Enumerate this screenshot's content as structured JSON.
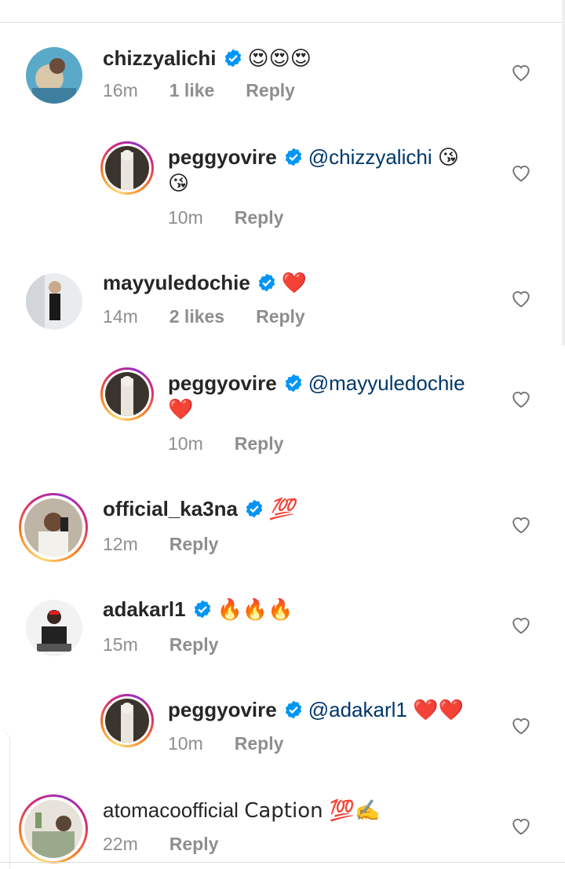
{
  "comments": [
    {
      "username": "chizzyalichi",
      "text": "😍😍😍",
      "time": "16m",
      "likes": "1 like",
      "reply": "Reply"
    },
    {
      "username": "peggyovire",
      "mention": "@chizzyalichi",
      "text": "😘",
      "text2": "😘",
      "time": "10m",
      "reply": "Reply"
    },
    {
      "username": "mayyuledochie",
      "text": "❤️",
      "time": "14m",
      "likes": "2 likes",
      "reply": "Reply"
    },
    {
      "username": "peggyovire",
      "mention": "@mayyuledochie",
      "text2": "❤️",
      "time": "10m",
      "reply": "Reply"
    },
    {
      "username": "official_ka3na",
      "text": "💯",
      "time": "12m",
      "reply": "Reply"
    },
    {
      "username": "adakarl1",
      "text": "🔥🔥🔥",
      "time": "15m",
      "reply": "Reply"
    },
    {
      "username": "peggyovire",
      "mention": "@adakarl1",
      "text": "❤️❤️",
      "time": "10m",
      "reply": "Reply"
    },
    {
      "username": "atomacoofficial",
      "text": "Caption 💯✍️",
      "time": "22m",
      "reply": "Reply"
    }
  ],
  "colors": {
    "mention": "#00376b",
    "meta": "#8e8e8e",
    "verified": "#0095f6",
    "heart": "#e0245e"
  },
  "icons": {
    "verified": "verified-badge-icon",
    "like": "heart-outline-icon"
  }
}
